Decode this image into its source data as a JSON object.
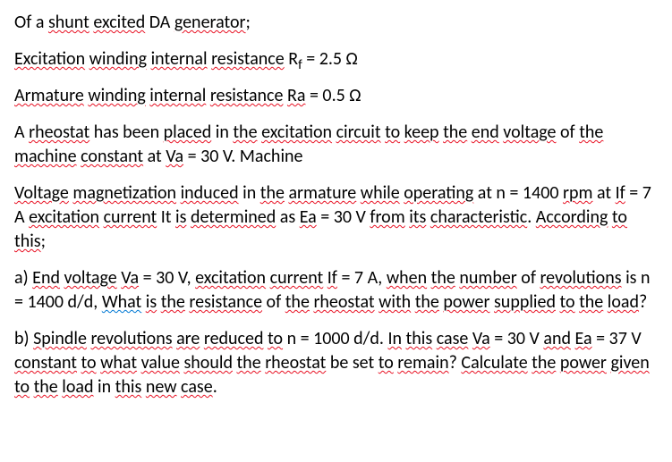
{
  "p1": {
    "t1": "Of a ",
    "t2": "shunt",
    "t3": " ",
    "t4": "excited",
    "t5": " DA ",
    "t6": "generator",
    "t7": ";"
  },
  "p2": {
    "t1": "Excitation",
    "t2": " ",
    "t3": "winding",
    "t4": " ",
    "t5": "internal",
    "t6": " ",
    "t7": "resistance",
    "t8": " R",
    "t8sub": "f",
    "t9": " = 2.5 Ω"
  },
  "p3": {
    "t1": "Armature",
    "t2": " ",
    "t3": "winding",
    "t4": " ",
    "t5": "internal",
    "t6": " ",
    "t7": "resistance",
    "t8": " ",
    "t9": "Ra",
    "t10": " = 0.5 Ω"
  },
  "p4": {
    "t1": "A ",
    "t2": "rheostat",
    "t3": " has been ",
    "t4": "placed",
    "t5": " in ",
    "t6": "the",
    "t7": " ",
    "t8": "excitation",
    "t9": " ",
    "t10": "circuit",
    "t11": " ",
    "t12": "to",
    "t13": " ",
    "t14": "keep",
    "t15": " ",
    "t16": "the",
    "t17": " ",
    "t18": "end",
    "t19": " ",
    "t20": "voltage",
    "t21": " of ",
    "t22": "the",
    "t23": " ",
    "t24": "machine",
    "t25": " ",
    "t26": "constant",
    "t27": " at ",
    "t28": "Va",
    "t29": " = 30 V. Machine"
  },
  "p5": {
    "t1": "Voltage",
    "t2": " ",
    "t3": "magnetization",
    "t4": " ",
    "t5": "induced",
    "t6": " in ",
    "t7": "the",
    "t8": " ",
    "t9": "armature",
    "t10": " ",
    "t11": "while",
    "t12": " ",
    "t13": "operating",
    "t14": " at n = 1400 ",
    "t15": "rpm",
    "t16": " at ",
    "t17": "If",
    "t18": " = 7 A ",
    "t19": "excitation",
    "t20": " ",
    "t21": "current",
    "t22": " It ",
    "t23": "is",
    "t24": " ",
    "t25": "determined",
    "t26": " as ",
    "t27": "Ea",
    "t28": " = 30 V ",
    "t29": "from",
    "t30": " ",
    "t31": "its",
    "t32": " ",
    "t33": "characteristic",
    "t34": ". ",
    "t35": "According",
    "t36": " ",
    "t37": "to",
    "t38": " ",
    "t39": "this",
    "t40": ";"
  },
  "p6": {
    "t1": "a) ",
    "t2": "End",
    "t3": " ",
    "t4": "voltage",
    "t5": " ",
    "t6": "Va",
    "t7": " = 30 V, ",
    "t8": "excitation",
    "t9": " ",
    "t10": "current",
    "t11": " ",
    "t12": "If",
    "t13": " = 7 A, ",
    "t14": "when",
    "t15": " ",
    "t16": "the",
    "t17": " ",
    "t18": "number",
    "t19": " of ",
    "t20": "revolutions",
    "t21": " is n = 1400 d/d, ",
    "t22": "What",
    "t23": " ",
    "t24": "is",
    "t25": " ",
    "t26": "the",
    "t27": " ",
    "t28": "resistance",
    "t29": " of ",
    "t30": "the",
    "t31": " ",
    "t32": "rheostat",
    "t33": " ",
    "t34": "with",
    "t35": " ",
    "t36": "the",
    "t37": " ",
    "t38": "power",
    "t39": " ",
    "t40": "supplied",
    "t41": " ",
    "t42": "to",
    "t43": " ",
    "t44": "the",
    "t45": " ",
    "t46": "load",
    "t47": "?"
  },
  "p7": {
    "t1": "b) ",
    "t2": "Spindle",
    "t3": " ",
    "t4": "revolutions",
    "t5": " ",
    "t6": "are",
    "t7": " ",
    "t8": "reduced",
    "t9": " ",
    "t10": "to",
    "t11": " n = 1000 d/d. ",
    "t12": "In",
    "t13": " ",
    "t14": "this",
    "t15": " ",
    "t16": "case",
    "t17": " ",
    "t18": "Va",
    "t19": " = 30 V ",
    "t20": "and",
    "t21": " ",
    "t22": "Ea",
    "t23": " = 37 V ",
    "t24": "constant",
    "t25": " ",
    "t26": "to",
    "t27": " ",
    "t28": "what",
    "t29": " ",
    "t30": "value",
    "t31": " ",
    "t32": "should",
    "t33": " ",
    "t34": "the",
    "t35": " ",
    "t36": "rheostat",
    "t37": " be set ",
    "t38": "to",
    "t39": " ",
    "t40": "remain",
    "t41": "? ",
    "t42": "Calculate",
    "t43": " ",
    "t44": "the",
    "t45": " ",
    "t46": "power",
    "t47": " ",
    "t48": "given",
    "t49": " ",
    "t50": "to",
    "t51": " ",
    "t52": "the",
    "t53": " ",
    "t54": "load",
    "t55": " in ",
    "t56": "this",
    "t57": " ",
    "t58": "new",
    "t59": " ",
    "t60": "case",
    "t61": "."
  }
}
